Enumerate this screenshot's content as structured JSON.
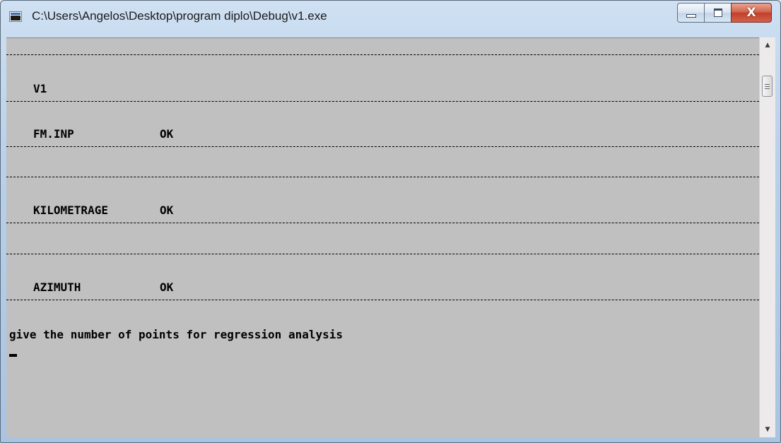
{
  "window": {
    "title": "C:\\Users\\Angelos\\Desktop\\program diplo\\Debug\\v1.exe"
  },
  "caption_buttons": {
    "close_glyph": "X"
  },
  "console": {
    "header": "V1",
    "rows": [
      {
        "name": "FM.INP",
        "status": "OK"
      },
      {
        "name": "KILOMETRAGE",
        "status": "OK"
      },
      {
        "name": "AZIMUTH",
        "status": "OK"
      }
    ],
    "prompt": "give the number of points for regression analysis"
  },
  "icons": {
    "app": "console-window-icon",
    "minimize": "minimize-icon",
    "maximize": "maximize-icon",
    "close": "close-icon",
    "scroll_up": "scroll-up-arrow-icon",
    "scroll_down": "scroll-down-arrow-icon"
  },
  "colors": {
    "console_background": "#c0c0c0",
    "console_text": "#000000",
    "close_button": "#c2402b"
  }
}
